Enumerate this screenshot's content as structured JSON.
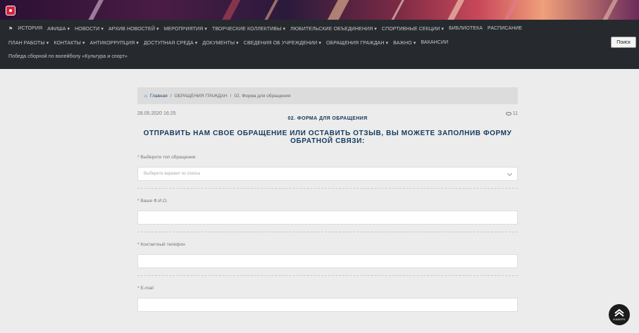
{
  "nav": {
    "row1": [
      "ИСТОРИЯ",
      "АФИША ▾",
      "НОВОСТИ ▾",
      "АРХИВ НОВОСТЕЙ ▾",
      "МЕРОПРИЯТИЯ ▾",
      "ТВОРЧЕСКИЕ КОЛЛЕКТИВЫ ▾",
      "ЛЮБИТЕЛЬСКИЕ ОБЪЕДИНЕНИЯ ▾",
      "СПОРТИВНЫЕ СЕКЦИИ ▾",
      "БИБЛИОТЕКА",
      "РАСПИСАНИЕ"
    ],
    "row2": [
      "ПЛАН РАБОТЫ ▾",
      "КОНТАКТЫ ▾",
      "АНТИКОРРУПЦИЯ ▾",
      "ДОСТУПНАЯ СРЕДА ▾",
      "ДОКУМЕНТЫ ▾",
      "СВЕДЕНИЯ ОБ УЧРЕЖДЕНИИ ▾",
      "ОБРАЩЕНИЯ ГРАЖДАН ▾",
      "ВАЖНО ▾",
      "ВАКАНСИИ"
    ],
    "row3": [
      "Победа сборной по волейболу «Культура и спорт»"
    ],
    "search_label": "Поиск"
  },
  "breadcrumb": {
    "home": "Главная",
    "sep": "/",
    "section": "ОБРАЩЕНИЯ ГРАЖДАН",
    "current": "02. Форма для обращения"
  },
  "meta": {
    "date": "28.05.2020 16:25",
    "views": "11"
  },
  "article": {
    "subtitle": "02. ФОРМА ДЛЯ ОБРАЩЕНИЯ",
    "headline": "ОТПРАВИТЬ НАМ СВОЕ ОБРАЩЕНИЕ ИЛИ ОСТАВИТЬ ОТЗЫВ, ВЫ МОЖЕТЕ ЗАПОЛНИВ ФОРМУ ОБРАТНОЙ СВЯЗИ:"
  },
  "form": {
    "type_label": "Выберите тип обращения",
    "type_placeholder": "Выберите вариант из списка",
    "name_label": "Ваше Ф.И.О.",
    "phone_label": "Контактный телефон",
    "email_label": "E-mail",
    "required_mark": "*"
  },
  "fab": {
    "label": "НАВЕРХ"
  },
  "colors": {
    "accent": "#14395c",
    "navbar": "#262a2e"
  }
}
